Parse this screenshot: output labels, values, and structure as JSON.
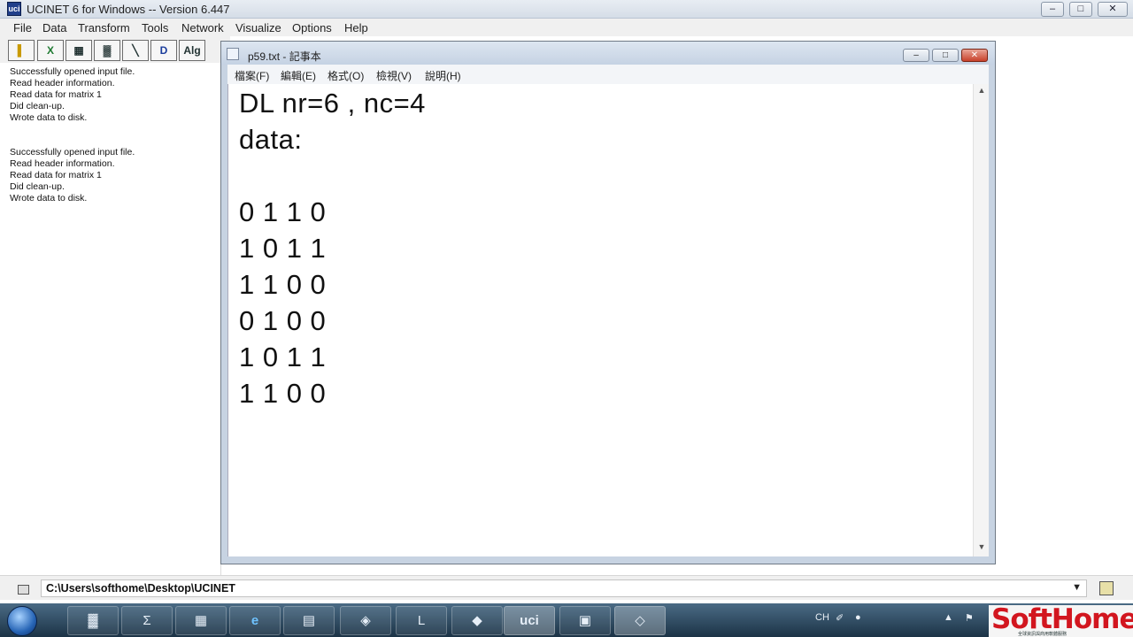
{
  "app": {
    "title": "UCINET 6 for Windows -- Version 6.447",
    "icon_label": "uci",
    "window_buttons": [
      "–",
      "□",
      "✕"
    ]
  },
  "menu": [
    "File",
    "Data",
    "Transform",
    "Tools",
    "Network",
    "Visualize",
    "Options",
    "Help"
  ],
  "toolbar": [
    "▌",
    "X",
    "▦",
    "▓",
    "╲",
    "D",
    "Alg"
  ],
  "log": {
    "block1": [
      "Successfully opened input file.",
      "Read header information.",
      "Read data for matrix 1",
      "Did clean-up.",
      "Wrote data to disk."
    ],
    "block2": [
      "Successfully opened input file.",
      "Read header information.",
      "Read data for matrix 1",
      "Did clean-up.",
      "Wrote data to disk."
    ]
  },
  "notepad": {
    "title": "p59.txt - 記事本",
    "window_buttons": [
      "–",
      "□",
      "✕"
    ],
    "menu": [
      "檔案(F)",
      "編輯(E)",
      "格式(O)",
      "檢視(V)",
      "說明(H)"
    ],
    "lines": [
      "DL nr=6 , nc=4",
      "data:",
      "",
      "0 1 1 0",
      "1 0 1 1",
      "1 1 0 0",
      "0 1 0 0",
      "1 0 1 1",
      "1 1 0 0"
    ],
    "scroll_up": "▲",
    "scroll_down": "▼"
  },
  "pathbar": {
    "path": "C:\\Users\\softhome\\Desktop\\UCINET",
    "dropdown": "▼"
  },
  "taskbar": {
    "tasks": [
      "▓",
      "Σ",
      "▦",
      "e",
      "▤",
      "◈",
      "L",
      "◆",
      "uci",
      "▣",
      "◇"
    ],
    "lang": "CH",
    "tray": [
      "✐",
      "●",
      "▲",
      "⚑"
    ],
    "watermark": "SoftHome",
    "watermark_sub": "全球資訊與商用軟體服務"
  },
  "colors": {
    "taskbar_top": "#4a6b85",
    "taskbar_bottom": "#1c3346",
    "watermark": "#d2161f",
    "notepad_frame": "#c7d3e2"
  }
}
